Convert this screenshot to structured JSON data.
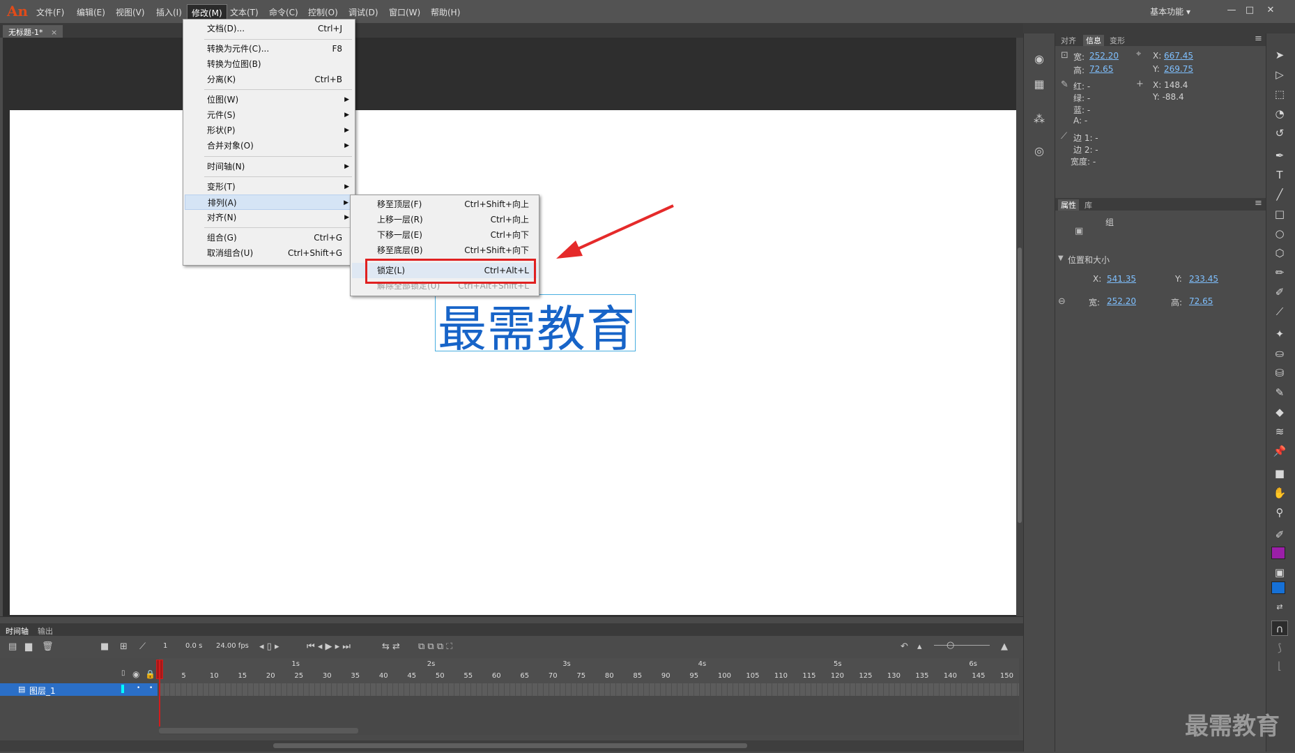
{
  "app": {
    "logo": "An",
    "workspace": "基本功能 ▾"
  },
  "menubar": [
    "文件(F)",
    "编辑(E)",
    "视图(V)",
    "插入(I)",
    "修改(M)",
    "文本(T)",
    "命令(C)",
    "控制(O)",
    "调试(D)",
    "窗口(W)",
    "帮助(H)"
  ],
  "document": {
    "tab_title": "无标题-1*",
    "text_object": "最需教育"
  },
  "modify_menu": [
    {
      "label": "文档(D)...",
      "shortcut": "Ctrl+J"
    },
    {
      "label": "转换为元件(C)...",
      "shortcut": "F8"
    },
    {
      "label": "转换为位图(B)",
      "shortcut": ""
    },
    {
      "label": "分离(K)",
      "shortcut": "Ctrl+B"
    },
    {
      "label": "位图(W)",
      "shortcut": ""
    },
    {
      "label": "元件(S)",
      "shortcut": ""
    },
    {
      "label": "形状(P)",
      "shortcut": ""
    },
    {
      "label": "合并对象(O)",
      "shortcut": ""
    },
    {
      "label": "时间轴(N)",
      "shortcut": ""
    },
    {
      "label": "变形(T)",
      "shortcut": ""
    },
    {
      "label": "排列(A)",
      "shortcut": ""
    },
    {
      "label": "对齐(N)",
      "shortcut": ""
    },
    {
      "label": "组合(G)",
      "shortcut": "Ctrl+G"
    },
    {
      "label": "取消组合(U)",
      "shortcut": "Ctrl+Shift+G"
    }
  ],
  "arrange_menu": [
    {
      "label": "移至顶层(F)",
      "shortcut": "Ctrl+Shift+向上"
    },
    {
      "label": "上移一层(R)",
      "shortcut": "Ctrl+向上"
    },
    {
      "label": "下移一层(E)",
      "shortcut": "Ctrl+向下"
    },
    {
      "label": "移至底层(B)",
      "shortcut": "Ctrl+Shift+向下"
    },
    {
      "label": "锁定(L)",
      "shortcut": "Ctrl+Alt+L"
    },
    {
      "label": "解除全部锁定(U)",
      "shortcut": "Ctrl+Alt+Shift+L"
    }
  ],
  "info_panel": {
    "tabs": [
      "对齐",
      "信息",
      "变形"
    ],
    "width_label": "宽:",
    "width": "252.20",
    "height_label": "高:",
    "height": "72.65",
    "x_label": "X:",
    "x": "667.45",
    "y_label": "Y:",
    "y": "269.75",
    "red_label": "红: -",
    "green_label": "绿: -",
    "blue_label": "蓝: -",
    "alpha_label": "A: -",
    "cursor_x": "X: 148.4",
    "cursor_y": "Y: -88.4",
    "edge1": "边 1: -",
    "edge2": "边 2: -",
    "stroke_width": "宽度: -"
  },
  "properties_panel": {
    "tabs": [
      "属性",
      "库"
    ],
    "object_type": "组",
    "section": "位置和大小",
    "x_label": "X:",
    "x": "541.35",
    "y_label": "Y:",
    "y": "233.45",
    "w_label": "宽:",
    "w": "252.20",
    "h_label": "高:",
    "h": "72.65"
  },
  "timeline": {
    "tabs": [
      "时间轴",
      "输出"
    ],
    "frame": "1",
    "time": "0.0 s",
    "fps": "24.00 fps",
    "seconds": [
      "1s",
      "2s",
      "3s",
      "4s",
      "5s",
      "6s"
    ],
    "frame_numbers": [
      "1",
      "5",
      "10",
      "15",
      "20",
      "25",
      "30",
      "35",
      "40",
      "45",
      "50",
      "55",
      "60",
      "65",
      "70",
      "75",
      "80",
      "85",
      "90",
      "95",
      "100",
      "105",
      "110",
      "115",
      "120",
      "125",
      "130",
      "135",
      "140",
      "145",
      "150"
    ],
    "layer_name": "图层_1"
  },
  "watermark": "最需教育",
  "colors": {
    "stroke": "#9b1fa8",
    "fill": "#1670d6",
    "text": "#1764c8",
    "highlight": "#e02020"
  }
}
